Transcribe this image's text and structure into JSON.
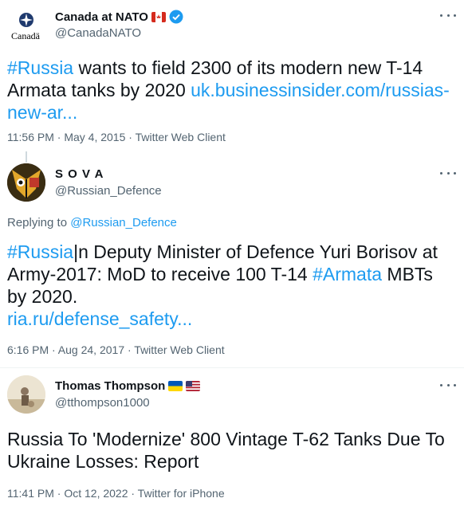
{
  "tweets": [
    {
      "display_name": "Canada at NATO",
      "handle": "@CanadaNATO",
      "logo_text": "Canadä",
      "text_parts": {
        "hashtag": "#Russia",
        "body": " wants to field 2300 of its modern new T-14 Armata tanks by 2020 ",
        "link": "uk.businessinsider.com/russias-new-ar..."
      },
      "meta": "11:56 PM · May 4, 2015 · Twitter Web Client"
    },
    {
      "display_name": "S O V A",
      "handle": "@Russian_Defence",
      "replying_prefix": "Replying to ",
      "replying_handle": "@Russian_Defence",
      "text_parts": {
        "hashtag1": "#Russia",
        "body1": "|n Deputy Minister of Defence Yuri Borisov at Army-2017: MoD to receive 100 T-14 ",
        "hashtag2": "#Armata",
        "body2": " MBTs by 2020.",
        "link": "ria.ru/defense_safety..."
      },
      "meta": "6:16 PM · Aug 24, 2017 · Twitter Web Client"
    },
    {
      "display_name": "Thomas Thompson",
      "handle": "@tthompson1000",
      "text": "Russia To 'Modernize' 800 Vintage T-62 Tanks Due To Ukraine Losses: Report",
      "meta": "11:41 PM · Oct 12, 2022 · Twitter for iPhone"
    }
  ],
  "colors": {
    "link": "#1d9bf0",
    "secondary": "#536471",
    "verified": "#1d9bf0"
  }
}
